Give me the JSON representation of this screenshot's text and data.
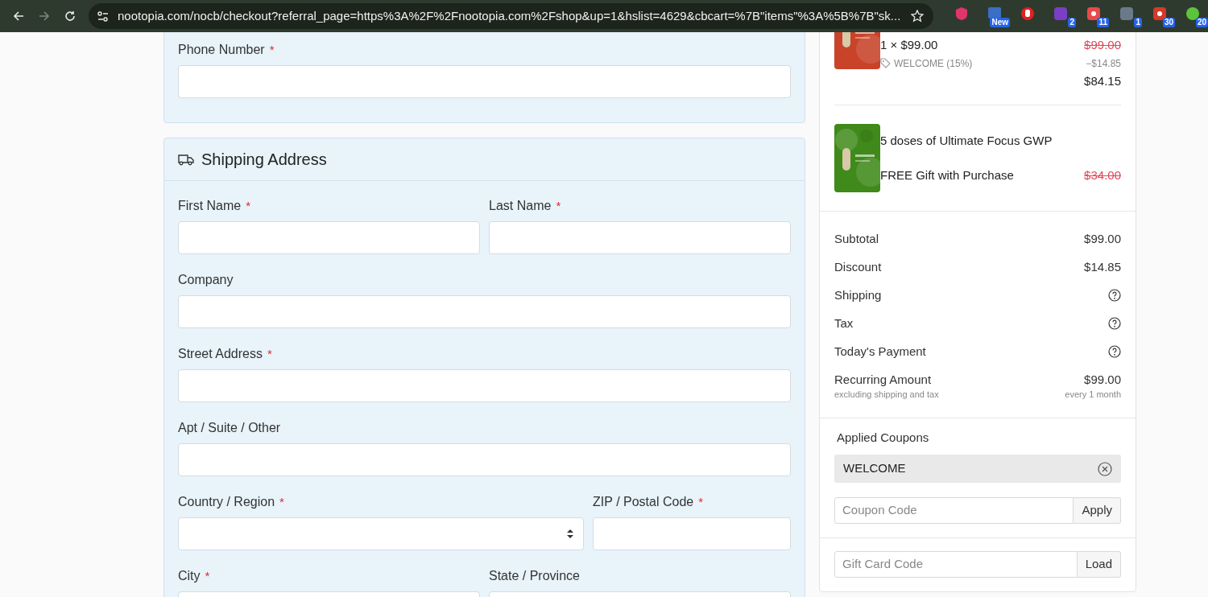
{
  "required_marker": "*",
  "browser": {
    "url": "nootopia.com/nocb/checkout?referral_page=https%3A%2F%2Fnootopia.com%2Fshop&up=1&hslist=4629&cbcart=%7B\"items\"%3A%5B%7B\"sk...",
    "extensions": [
      {
        "kind": "shield",
        "color": "#e0356b"
      },
      {
        "kind": "badge",
        "color": "#3a6fc4",
        "badge": "New"
      },
      {
        "kind": "hand",
        "color": "#e02020"
      },
      {
        "kind": "letter",
        "color": "#7a3fc4",
        "badge": "2"
      },
      {
        "kind": "tile",
        "color": "#e84a4a",
        "badge": "11"
      },
      {
        "kind": "dots",
        "color": "#6a7a8a",
        "badge": "1"
      },
      {
        "kind": "tile",
        "color": "#d43a2a",
        "badge": "30"
      },
      {
        "kind": "circle",
        "color": "#5cc43a",
        "badge": "20"
      }
    ]
  },
  "contact": {
    "fields": [
      [
        {
          "label": "Phone Number",
          "required": true,
          "kind": "text"
        }
      ]
    ]
  },
  "shipping": {
    "title": "Shipping Address",
    "fields": [
      [
        {
          "label": "First Name",
          "required": true,
          "kind": "text"
        },
        {
          "label": "Last Name",
          "required": true,
          "kind": "text"
        }
      ],
      [
        {
          "label": "Company",
          "required": false,
          "kind": "text"
        }
      ],
      [
        {
          "label": "Street Address",
          "required": true,
          "kind": "text"
        }
      ],
      [
        {
          "label": "Apt / Suite / Other",
          "required": false,
          "kind": "text"
        }
      ],
      [
        {
          "label": "Country / Region",
          "required": true,
          "kind": "select"
        },
        {
          "label": "ZIP / Postal Code",
          "required": true,
          "kind": "text"
        }
      ],
      [
        {
          "label": "City",
          "required": true,
          "kind": "text"
        },
        {
          "label": "State / Province",
          "required": false,
          "kind": "text"
        }
      ]
    ]
  },
  "cart": {
    "items": [
      {
        "kind": "discounted",
        "color": "#c8432a",
        "quantity_line": "1 × $99.00",
        "original_price": "$99.00",
        "coupon": "WELCOME (15%)",
        "discount": "−$14.85",
        "price": "$84.15"
      },
      {
        "kind": "gift",
        "color": "#3f8a1a",
        "name": "5 doses of Ultimate Focus GWP",
        "note": "FREE Gift with Purchase",
        "original_price": "$34.00"
      }
    ],
    "summary": [
      {
        "label": "Subtotal",
        "value": "$99.00"
      },
      {
        "label": "Discount",
        "value": "$14.85"
      },
      {
        "label": "Shipping",
        "help": true
      },
      {
        "label": "Tax",
        "help": true
      },
      {
        "label": "Today's Payment",
        "help": true
      },
      {
        "label": "Recurring Amount",
        "value": "$99.00",
        "sub_label": "excluding shipping and tax",
        "sub_value": "every 1 month"
      }
    ],
    "coupons": {
      "title": "Applied Coupons",
      "applied": [
        "WELCOME"
      ],
      "placeholder": "Coupon Code",
      "button": "Apply"
    },
    "gift_card": {
      "placeholder": "Gift Card Code",
      "button": "Load"
    }
  }
}
